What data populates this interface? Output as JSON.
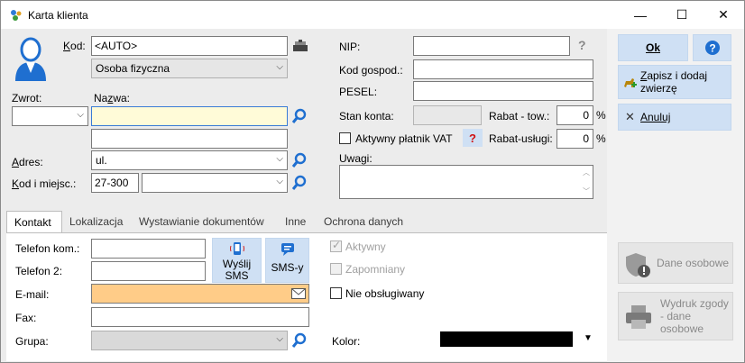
{
  "window": {
    "title": "Karta klienta",
    "minimize_glyph": "—",
    "maximize_glyph": "☐",
    "close_glyph": "✕"
  },
  "client": {
    "kod_label": "Kod:",
    "kod_value": "<AUTO>",
    "type_value": "Osoba fizyczna",
    "zwrot_label": "Zwrot:",
    "nazwa_label": "Nazwa:",
    "adres_label": "Adres:",
    "adres_value": "ul.",
    "kod_miejsc_label": "Kod i miejsc.:",
    "kod_pocztowy_value": "27-300"
  },
  "finance": {
    "nip_label": "NIP:",
    "nip_help": "?",
    "kod_gospod_label": "Kod gospod.:",
    "pesel_label": "PESEL:",
    "stan_konta_label": "Stan konta:",
    "rabat_tow_label": "Rabat - tow.:",
    "rabat_tow_value": "0",
    "rabat_usl_label": "Rabat-usługi:",
    "rabat_usl_value": "0",
    "percent": "%",
    "vat_label": "Aktywny płatnik VAT",
    "vat_help": "?",
    "uwagi_label": "Uwagi:"
  },
  "actions": {
    "ok_label": "Ok",
    "help_glyph": "?",
    "save_add_label": "Zapisz i dodaj zwierzę",
    "cancel_label": "Anuluj",
    "personal_data_label": "Dane osobowe",
    "print_consent_label": "Wydruk zgody - dane osobowe"
  },
  "tabs": [
    {
      "label": "Kontakt"
    },
    {
      "label": "Lokalizacja"
    },
    {
      "label": "Wystawianie dokumentów"
    },
    {
      "label": "Inne"
    },
    {
      "label": "Ochrona danych"
    }
  ],
  "contact": {
    "telefon_kom_label": "Telefon kom.:",
    "telefon2_label": "Telefon 2:",
    "email_label": "E-mail:",
    "fax_label": "Fax:",
    "grupa_label": "Grupa:",
    "send_sms_label": "Wyślij SMS",
    "sms_list_label": "SMS-y",
    "aktywny_label": "Aktywny",
    "zapomniany_label": "Zapomniany",
    "nieobslugiwany_label": "Nie obsługiwany",
    "kolor_label": "Kolor:",
    "kolor_value": "#000000"
  },
  "colors": {
    "accent_blue": "#1f6fd0",
    "button_blue": "#cfe0f4",
    "email_bg": "#ffcc88",
    "nazwa_bg": "#fffbd8"
  }
}
